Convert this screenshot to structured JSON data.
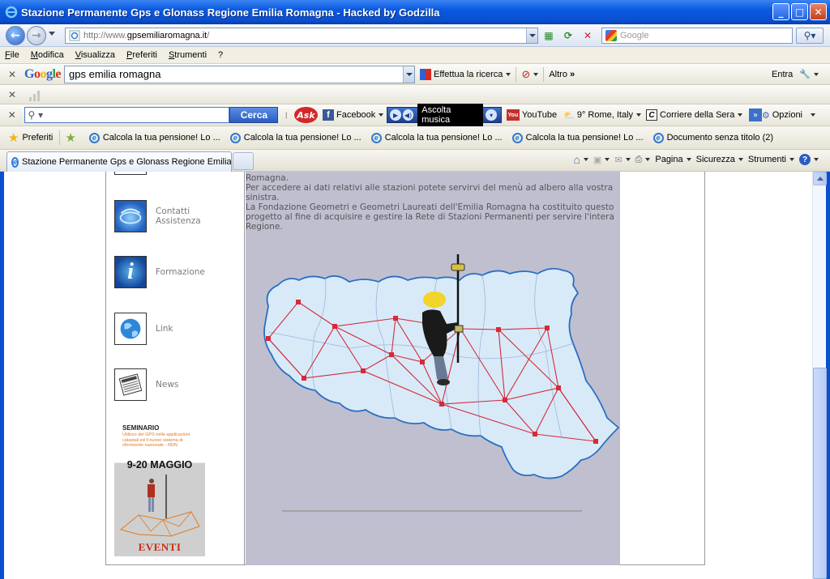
{
  "window": {
    "title": "Stazione Permanente Gps e Glonass Regione Emilia Romagna - Hacked by Godzilla"
  },
  "address_bar": {
    "url_prefix": "http://www.",
    "url_domain": "gpsemiliaromagna.it",
    "url_suffix": "/",
    "search_placeholder": "Google"
  },
  "menu": [
    "File",
    "Modifica",
    "Visualizza",
    "Preferiti",
    "Strumenti",
    "?"
  ],
  "google_toolbar": {
    "logo_letters": [
      "G",
      "o",
      "o",
      "g",
      "l",
      "e"
    ],
    "query": "gps emilia romagna",
    "search_button": "Effettua la ricerca",
    "more": "Altro",
    "signin": "Entra"
  },
  "ask_toolbar": {
    "search_button": "Cerca",
    "ask_logo": "Ask",
    "facebook": "Facebook",
    "music": "Ascolta musica",
    "youtube": "YouTube",
    "weather": "9° Rome, Italy",
    "news": "Corriere della Sera",
    "options": "Opzioni"
  },
  "favorites_bar": {
    "favorites_label": "Preferiti",
    "items": [
      "Calcola la tua pensione! Lo ...",
      "Calcola la tua pensione! Lo ...",
      "Calcola la tua pensione! Lo ...",
      "Calcola la tua pensione! Lo ...",
      "Documento senza titolo (2)"
    ]
  },
  "tab": {
    "label": "Stazione Permanente Gps e Glonass Regione Emilia Ro..."
  },
  "command_bar": {
    "page": "Pagina",
    "security": "Sicurezza",
    "tools": "Strumenti"
  },
  "sidebar": {
    "items": [
      {
        "label_lines": [
          "Contatti",
          "Assistenza"
        ],
        "icon": "contact-icon"
      },
      {
        "label_lines": [
          "Formazione"
        ],
        "icon": "info-icon"
      },
      {
        "label_lines": [
          "Link"
        ],
        "icon": "globe-icon"
      },
      {
        "label_lines": [
          "News"
        ],
        "icon": "newspaper-icon"
      }
    ],
    "promo": {
      "heading": "SEMINARIO",
      "subtitle": "Utilizzo del GPS nelle applicazioni catastali ed il nuovo sistema di riferimento nazionale - RDN",
      "dates": "9-20 MAGGIO",
      "footer": "EVENTI"
    }
  },
  "main": {
    "text_lines": [
      "Romagna.",
      "Per accedere ai dati relativi alle stazioni potete servirvi del menù ad albero alla vostra",
      "sinistra.",
      "La Fondazione Geometri e Geometri Laureati dell'Emilia Romagna ha costituito questo",
      "progetto al fine di acquisire e gestire la Rete di Stazioni Permanenti per servire l'intera",
      "Regione."
    ]
  },
  "colors": {
    "titlebar_blue": "#0a5ae0",
    "map_fill": "#d8eaf8",
    "map_outline": "#2a6fc0",
    "network_red": "#d42a3a",
    "content_bg": "#c0bfd0"
  }
}
